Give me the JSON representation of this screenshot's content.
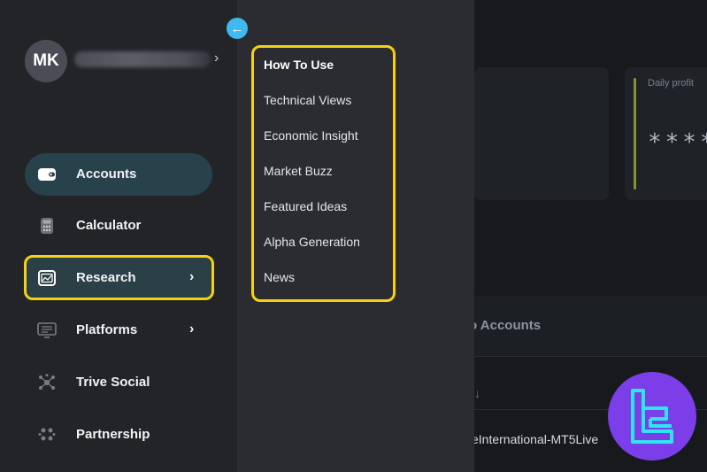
{
  "profile": {
    "initials": "MK",
    "chevron": "›"
  },
  "collapse_button": {
    "icon": "arrow-left-icon",
    "glyph": "←"
  },
  "sidebar": {
    "items": [
      {
        "label": "Accounts",
        "icon": "wallet-icon",
        "active": true
      },
      {
        "label": "Calculator",
        "icon": "calculator-icon"
      },
      {
        "label": "Research",
        "icon": "chart-window-icon",
        "highlighted": true,
        "chevron": "›"
      },
      {
        "label": "Platforms",
        "icon": "monitor-icon",
        "chevron": "›"
      },
      {
        "label": "Trive Social",
        "icon": "network-icon"
      },
      {
        "label": "Partnership",
        "icon": "people-icon"
      }
    ]
  },
  "research_menu": {
    "items": [
      {
        "label": "How To Use"
      },
      {
        "label": "Technical Views"
      },
      {
        "label": "Economic Insight"
      },
      {
        "label": "Market Buzz"
      },
      {
        "label": "Featured Ideas"
      },
      {
        "label": "Alpha Generation"
      },
      {
        "label": "News"
      }
    ]
  },
  "background": {
    "card_label": "Daily profit",
    "card_value_masked": "****",
    "section_title": "o Accounts",
    "sort_arrow": "↓",
    "server_name": "eInternational-MT5Live"
  },
  "colors": {
    "highlight": "#f6d113",
    "accent": "#3fb9ee",
    "active_item_bg": "#28424c",
    "logo_bg": "#7b3ee8",
    "logo_fg": "#2ee6f2"
  },
  "logo": {
    "icon": "tradingfinder-logo-icon"
  }
}
